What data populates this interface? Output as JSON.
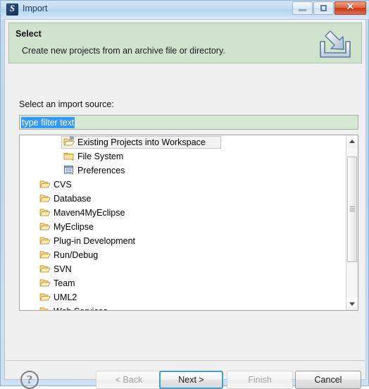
{
  "window": {
    "title": "Import",
    "app_icon": "eclipse-icon",
    "icon_glyph": "S",
    "controls": {
      "minimize": "minimize-button",
      "maximize": "maximize-button",
      "close_glyph": "✕"
    },
    "ghost_artifacts": [
      "     ",
      "      "
    ]
  },
  "banner": {
    "title": "Select",
    "description": "Create new projects from an archive file or directory.",
    "icon": "import-arrow-into-tray-icon",
    "background_color": "#cfe3cd"
  },
  "body": {
    "source_label": "Select an import source:",
    "filter": {
      "value": "type filter text",
      "placeholder": "type filter text",
      "selected": true,
      "selection_color": "#3399ff",
      "field_background": "#d7e8d5"
    }
  },
  "tree": {
    "items": [
      {
        "label": "Existing Projects into Workspace",
        "icon": "open-folder-project-icon",
        "depth": 1,
        "selected": true
      },
      {
        "label": "File System",
        "icon": "closed-folder-icon",
        "depth": 1,
        "selected": false
      },
      {
        "label": "Preferences",
        "icon": "preferences-list-icon",
        "depth": 1,
        "selected": false
      },
      {
        "label": "CVS",
        "icon": "open-folder-icon",
        "depth": 0,
        "selected": false
      },
      {
        "label": "Database",
        "icon": "open-folder-icon",
        "depth": 0,
        "selected": false
      },
      {
        "label": "Maven4MyEclipse",
        "icon": "open-folder-icon",
        "depth": 0,
        "selected": false
      },
      {
        "label": "MyEclipse",
        "icon": "open-folder-icon",
        "depth": 0,
        "selected": false
      },
      {
        "label": "Plug-in Development",
        "icon": "open-folder-icon",
        "depth": 0,
        "selected": false
      },
      {
        "label": "Run/Debug",
        "icon": "open-folder-icon",
        "depth": 0,
        "selected": false
      },
      {
        "label": "SVN",
        "icon": "open-folder-icon",
        "depth": 0,
        "selected": false
      },
      {
        "label": "Team",
        "icon": "open-folder-icon",
        "depth": 0,
        "selected": false
      },
      {
        "label": "UML2",
        "icon": "open-folder-icon",
        "depth": 0,
        "selected": false
      },
      {
        "label": "Web Services",
        "icon": "open-folder-icon",
        "depth": 0,
        "selected": false
      }
    ],
    "scrollbar": {
      "up_arrow": "scroll-up-arrow",
      "down_arrow": "scroll-down-arrow"
    }
  },
  "footer": {
    "help_glyph": "?",
    "buttons": [
      {
        "label": "< Back",
        "state": "disabled"
      },
      {
        "label": "Next >",
        "state": "default"
      },
      {
        "label": "Finish",
        "state": "disabled"
      },
      {
        "label": "Cancel",
        "state": "normal"
      }
    ]
  }
}
